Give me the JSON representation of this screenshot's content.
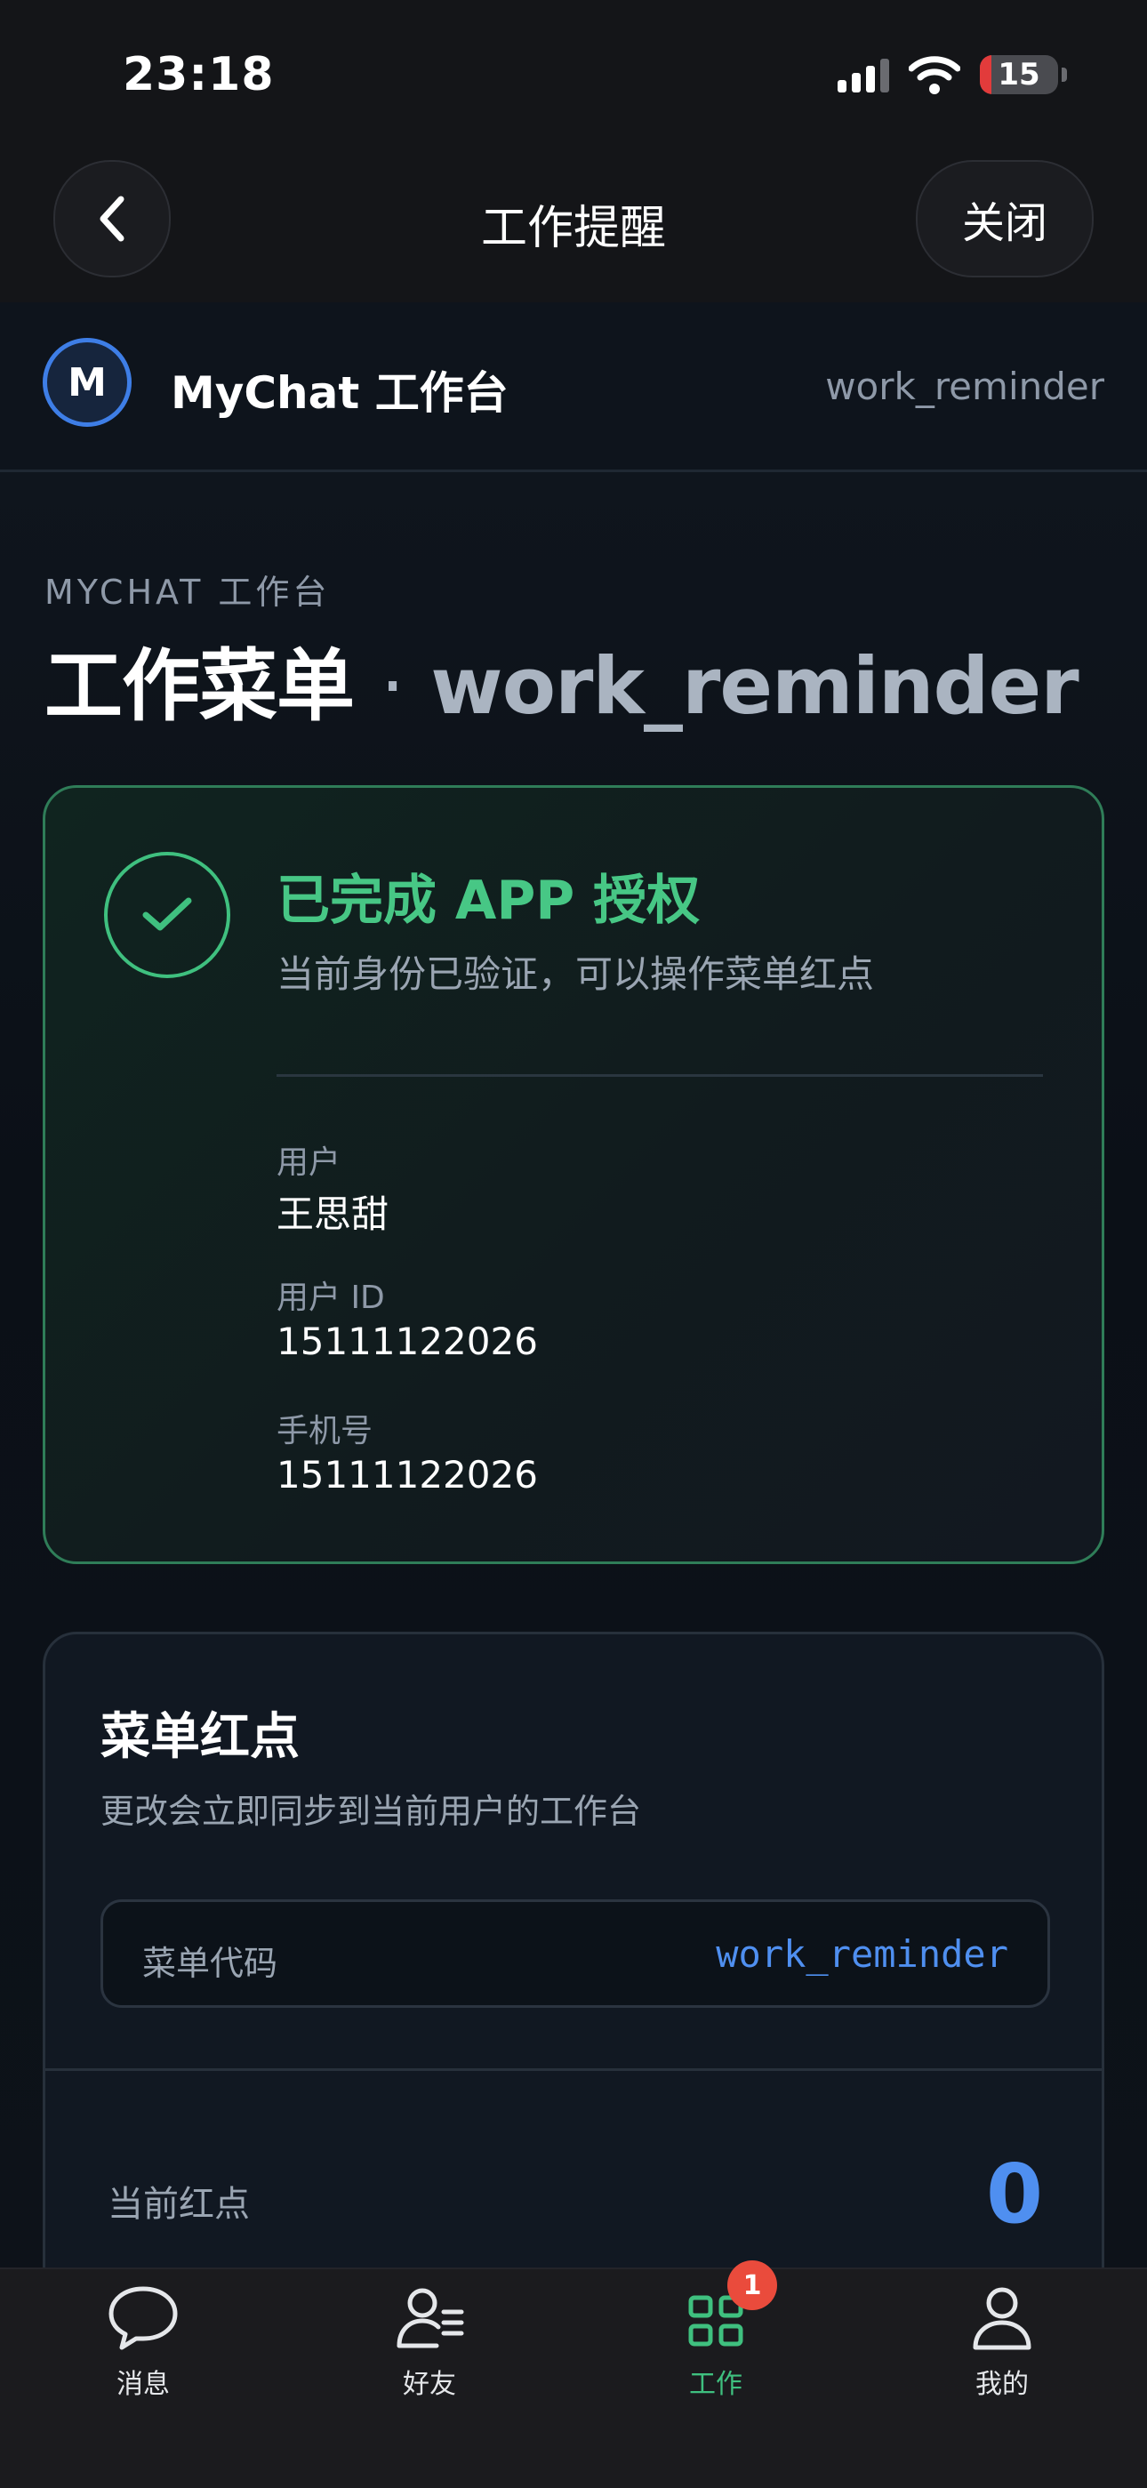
{
  "status_bar": {
    "time": "23:18",
    "battery_level": "15",
    "battery_fill_percent": 15,
    "icons": [
      "signal-icon",
      "wifi-icon",
      "battery-icon"
    ]
  },
  "nav": {
    "title": "工作提醒",
    "close_label": "关闭",
    "back_icon": "chevron-left-icon"
  },
  "app_bar": {
    "avatar_letter": "M",
    "name": "MyChat 工作台",
    "code": "work_reminder"
  },
  "page": {
    "eyebrow": "MYCHAT 工作台",
    "title": "工作菜单",
    "title_sep": "·",
    "title_code": "work_reminder"
  },
  "auth": {
    "title": "已完成 APP 授权",
    "subtitle": "当前身份已验证，可以操作菜单红点",
    "fields": [
      {
        "label": "用户",
        "value": "王思甜"
      },
      {
        "label": "用户 ID",
        "value": "15111122026"
      },
      {
        "label": "手机号",
        "value": "15111122026"
      }
    ]
  },
  "menu_badge": {
    "title": "菜单红点",
    "subtitle": "更改会立即同步到当前用户的工作台",
    "code_label": "菜单代码",
    "code_value": "work_reminder",
    "current_label": "当前红点",
    "current_value": "0"
  },
  "tab_bar": {
    "tabs": [
      {
        "label": "消息",
        "icon": "chat-bubble-icon",
        "active": false
      },
      {
        "label": "好友",
        "icon": "contacts-icon",
        "active": false
      },
      {
        "label": "工作",
        "icon": "grid-icon",
        "active": true,
        "badge": "1"
      },
      {
        "label": "我的",
        "icon": "user-icon",
        "active": false
      }
    ]
  },
  "colors": {
    "accent_green": "#47c785",
    "accent_blue": "#4f8ff0",
    "badge_red": "#ea4b3c",
    "background": "#0c1118"
  }
}
